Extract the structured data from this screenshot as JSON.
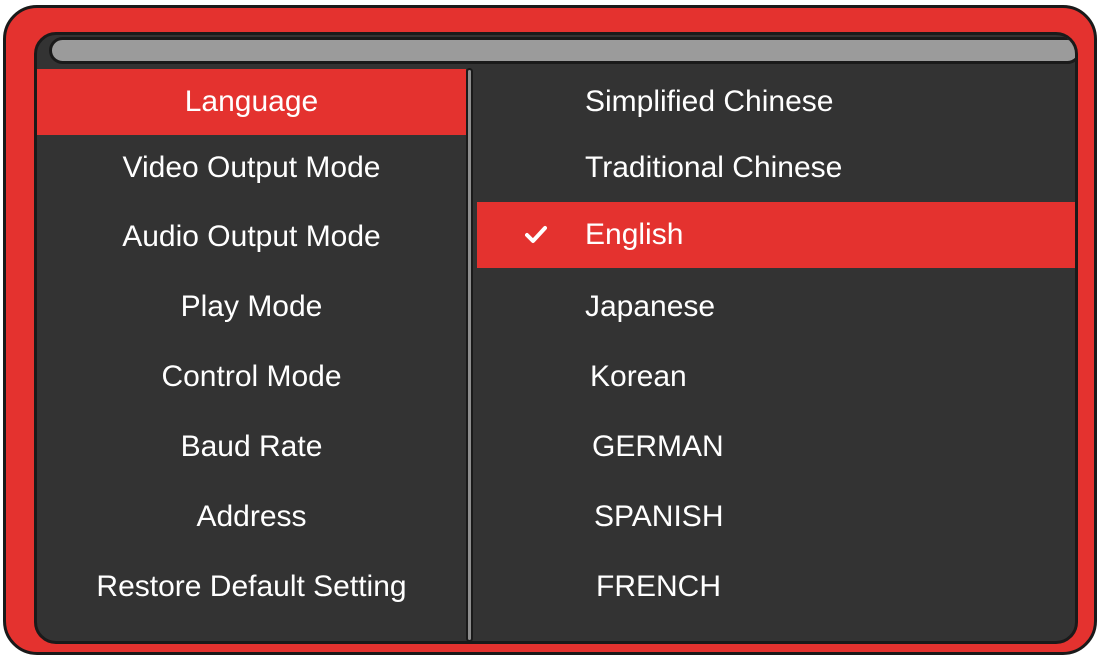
{
  "menu": {
    "left_items": [
      {
        "label": "Language",
        "selected": true
      },
      {
        "label": "Video Output Mode",
        "selected": false
      },
      {
        "label": "Audio Output Mode",
        "selected": false
      },
      {
        "label": "Play Mode",
        "selected": false
      },
      {
        "label": "Control Mode",
        "selected": false
      },
      {
        "label": "Baud Rate",
        "selected": false
      },
      {
        "label": "Address",
        "selected": false
      },
      {
        "label": "Restore Default Setting",
        "selected": false
      }
    ],
    "right_items": [
      {
        "label": "Simplified Chinese",
        "selected": false
      },
      {
        "label": "Traditional Chinese",
        "selected": false
      },
      {
        "label": "English",
        "selected": true,
        "icon": "checkmark-icon"
      },
      {
        "label": "Japanese",
        "selected": false
      },
      {
        "label": "Korean",
        "selected": false
      },
      {
        "label": "GERMAN",
        "selected": false
      },
      {
        "label": "SPANISH",
        "selected": false
      },
      {
        "label": "FRENCH",
        "selected": false
      }
    ]
  },
  "colors": {
    "accent": "#e4322f",
    "panel_background": "#333333",
    "title_bar": "#9b9b9b",
    "text": "#ffffff"
  }
}
